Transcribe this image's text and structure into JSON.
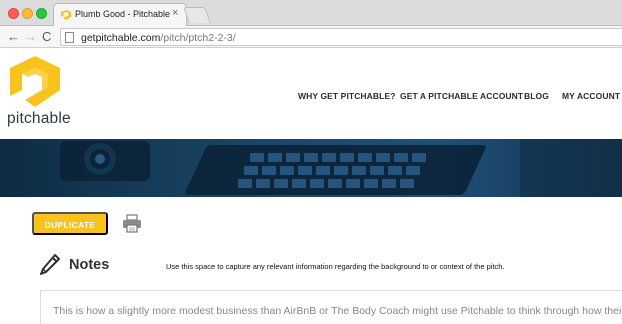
{
  "browser": {
    "tab_title": "Plumb Good - Pitchable",
    "tab_close": "×",
    "nav_back": "←",
    "nav_forward": "→",
    "nav_reload": "C",
    "url_host": "getpitchable.com",
    "url_path": "/pitch/ptch2-2-3/"
  },
  "site": {
    "logo_text": "pitchable",
    "nav": [
      {
        "label": "WHY GET PITCHABLE?"
      },
      {
        "label": "GET A PITCHABLE ACCOUNT"
      },
      {
        "label": "BLOG"
      },
      {
        "label": "MY ACCOUNT"
      }
    ]
  },
  "actions": {
    "duplicate_label": "DUPLICATE"
  },
  "notes": {
    "title": "Notes",
    "description": "Use this space to capture any relevant information regarding the background to or context of the pitch.",
    "text": "This is how a slightly more modest business than AirBnB or The Body Coach might use Pitchable to think through how their b"
  },
  "colors": {
    "brand_yellow": "#f8c31d",
    "hero_navy": "#1a4566"
  },
  "icons": {
    "logo": "pitchable-logo-icon",
    "print": "printer-icon",
    "notes": "pencil-icon"
  }
}
